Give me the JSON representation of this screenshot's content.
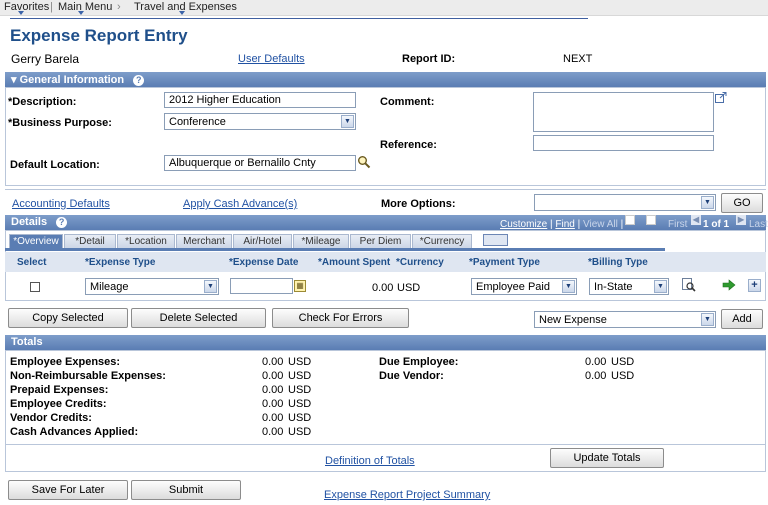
{
  "nav": {
    "favorites": "Favorites",
    "main_menu": "Main Menu",
    "breadcrumb": "Travel and Expenses"
  },
  "page": {
    "title": "Expense Report Entry",
    "user_name": "Gerry Barela",
    "user_defaults": "User Defaults",
    "report_id_label": "Report ID:",
    "report_id_value": "NEXT"
  },
  "general": {
    "header": "General Information",
    "description_label": "*Description:",
    "description_value": "2012 Higher Education",
    "purpose_label": "*Business Purpose:",
    "purpose_value": "Conference",
    "location_label": "Default Location:",
    "location_value": "Albuquerque or Bernalilo Cnty",
    "comment_label": "Comment:",
    "reference_label": "Reference:"
  },
  "options": {
    "accounting_defaults": "Accounting Defaults",
    "apply_cash_advance": "Apply Cash Advance(s)",
    "more_options_label": "More Options:",
    "go": "GO"
  },
  "details": {
    "header": "Details",
    "nav_links": {
      "customize": "Customize",
      "find": "Find",
      "view_all": "View All",
      "first": "First",
      "count": "1 of 1",
      "last": "Last"
    },
    "tabs": [
      "*Overview",
      "*Detail",
      "*Location",
      "Merchant",
      "Air/Hotel",
      "*Mileage",
      "Per Diem",
      "*Currency"
    ],
    "columns": {
      "select": "Select",
      "expense_type": "*Expense Type",
      "expense_date": "*Expense Date",
      "amount": "*Amount Spent",
      "currency": "*Currency",
      "payment_type": "*Payment Type",
      "billing_type": "*Billing Type"
    },
    "row": {
      "expense_type": "Mileage",
      "expense_date": "",
      "amount": "0.00",
      "currency": "USD",
      "payment_type": "Employee Paid",
      "billing_type": "In-State"
    }
  },
  "actions": {
    "copy": "Copy Selected",
    "delete": "Delete Selected",
    "check": "Check For Errors",
    "new_expense": "New Expense",
    "add": "Add"
  },
  "totals": {
    "header": "Totals",
    "left": [
      {
        "label": "Employee Expenses:",
        "amount": "0.00",
        "currency": "USD"
      },
      {
        "label": "Non-Reimbursable Expenses:",
        "amount": "0.00",
        "currency": "USD"
      },
      {
        "label": "Prepaid Expenses:",
        "amount": "0.00",
        "currency": "USD"
      },
      {
        "label": "Employee Credits:",
        "amount": "0.00",
        "currency": "USD"
      },
      {
        "label": "Vendor Credits:",
        "amount": "0.00",
        "currency": "USD"
      },
      {
        "label": "Cash Advances Applied:",
        "amount": "0.00",
        "currency": "USD"
      }
    ],
    "right": [
      {
        "label": "Due Employee:",
        "amount": "0.00",
        "currency": "USD"
      },
      {
        "label": "Due Vendor:",
        "amount": "0.00",
        "currency": "USD"
      }
    ],
    "definition_link": "Definition of Totals",
    "update_button": "Update Totals"
  },
  "footer": {
    "save_later": "Save For Later",
    "submit": "Submit",
    "project_summary": "Expense Report Project Summary"
  }
}
